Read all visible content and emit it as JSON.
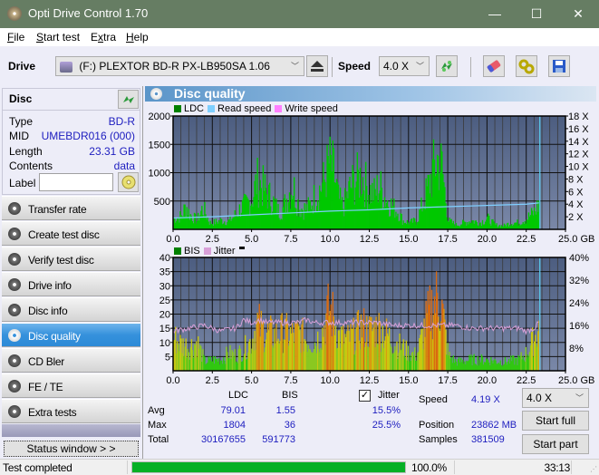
{
  "window": {
    "title": "Opti Drive Control 1.70",
    "minimize_label": "—",
    "maximize_label": "☐",
    "close_label": "✕"
  },
  "menu": {
    "items": [
      {
        "label": "File",
        "accel": "F",
        "rest": "ile"
      },
      {
        "label": "Start test",
        "accel": "S",
        "rest": "tart test"
      },
      {
        "label": "Extra",
        "accel_pre": "E",
        "accel": "x",
        "rest": "tra"
      },
      {
        "label": "Help",
        "accel": "H",
        "rest": "elp"
      }
    ]
  },
  "toolbar": {
    "drive_label": "Drive",
    "drive_value": "(F:)  PLEXTOR BD-R  PX-LB950SA 1.06",
    "speed_label": "Speed",
    "speed_value": "4.0 X",
    "icons": [
      "eject-icon",
      "refresh-icon",
      "erase-icon",
      "settings-icon",
      "save-icon"
    ]
  },
  "disc": {
    "header": "Disc",
    "rows": [
      {
        "label": "Type",
        "value": "BD-R"
      },
      {
        "label": "MID",
        "value": "UMEBDR016 (000)"
      },
      {
        "label": "Length",
        "value": "23.31 GB"
      },
      {
        "label": "Contents",
        "value": "data"
      }
    ],
    "label_field_label": "Label",
    "label_field_value": ""
  },
  "nav": {
    "items": [
      {
        "label": "Transfer rate",
        "active": false
      },
      {
        "label": "Create test disc",
        "active": false
      },
      {
        "label": "Verify test disc",
        "active": false
      },
      {
        "label": "Drive info",
        "active": false
      },
      {
        "label": "Disc info",
        "active": false
      },
      {
        "label": "Disc quality",
        "active": true
      },
      {
        "label": "CD Bler",
        "active": false
      },
      {
        "label": "FE / TE",
        "active": false
      },
      {
        "label": "Extra tests",
        "active": false
      }
    ],
    "status_window_label": "Status window > >"
  },
  "panel": {
    "title": "Disc quality"
  },
  "chart_data": [
    {
      "type": "area",
      "title": "LDC / Read speed",
      "legend": [
        {
          "name": "LDC",
          "color": "#008000"
        },
        {
          "name": "Read speed",
          "color": "#7fcfff"
        },
        {
          "name": "Write speed",
          "color": "#ff80ff"
        }
      ],
      "legend_position": "top-left",
      "xlabel": "GB",
      "x_ticks": [
        "0.0",
        "2.5",
        "5.0",
        "7.5",
        "10.0",
        "12.5",
        "15.0",
        "17.5",
        "20.0",
        "22.5",
        "25.0 GB"
      ],
      "xlim": [
        0,
        25
      ],
      "y_ticks": [
        "500",
        "1000",
        "1500",
        "2000"
      ],
      "ylim": [
        0,
        2000
      ],
      "y2_ticks": [
        "2 X",
        "4 X",
        "6 X",
        "8 X",
        "10 X",
        "12 X",
        "14 X",
        "16 X",
        "18 X"
      ],
      "y2lim": [
        0,
        18
      ],
      "grid": true,
      "series": [
        {
          "name": "LDC",
          "x": [
            0.0,
            0.5,
            0.8,
            1.0,
            1.5,
            1.8,
            2.0,
            2.3,
            2.5,
            3.0,
            3.5,
            4.0,
            4.3,
            4.6,
            5.0,
            5.3,
            5.6,
            6.0,
            6.3,
            6.7,
            7.0,
            7.3,
            7.6,
            8.0,
            8.5,
            9.0,
            9.3,
            9.6,
            9.9,
            10.2,
            10.5,
            10.8,
            11.2,
            11.5,
            12.0,
            12.4,
            12.8,
            13.1,
            13.5,
            14.0,
            14.3,
            14.6,
            15.0,
            15.5,
            16.0,
            16.5,
            16.8,
            17.1,
            17.5,
            18.0,
            18.5,
            19.0,
            19.5,
            20.0,
            20.5,
            21.0,
            21.5,
            22.0,
            22.5,
            23.0,
            23.31
          ],
          "values": [
            250,
            300,
            550,
            350,
            200,
            450,
            400,
            150,
            150,
            200,
            180,
            350,
            500,
            550,
            700,
            1100,
            1000,
            800,
            650,
            400,
            500,
            800,
            1000,
            500,
            450,
            750,
            900,
            1100,
            1500,
            1300,
            700,
            500,
            900,
            1100,
            1200,
            900,
            800,
            1000,
            700,
            500,
            400,
            200,
            150,
            200,
            700,
            1300,
            1600,
            1400,
            200,
            100,
            150,
            200,
            150,
            250,
            100,
            80,
            150,
            150,
            250,
            400,
            600
          ]
        },
        {
          "name": "Read speed",
          "x": [
            0.0,
            2.5,
            5.0,
            7.5,
            10.0,
            12.5,
            15.0,
            17.5,
            20.0,
            22.5,
            23.31
          ],
          "values": [
            1.8,
            2.0,
            2.3,
            2.6,
            2.9,
            3.1,
            3.4,
            3.6,
            3.8,
            4.0,
            4.2
          ]
        }
      ]
    },
    {
      "type": "area",
      "title": "BIS / Jitter",
      "legend": [
        {
          "name": "BIS",
          "color": "#008000"
        },
        {
          "name": "Jitter",
          "color": "#d8a0d8"
        }
      ],
      "legend_position": "top-left",
      "xlabel": "GB",
      "x_ticks": [
        "0.0",
        "2.5",
        "5.0",
        "7.5",
        "10.0",
        "12.5",
        "15.0",
        "17.5",
        "20.0",
        "22.5",
        "25.0 GB"
      ],
      "xlim": [
        0,
        25
      ],
      "y_ticks": [
        "5",
        "10",
        "15",
        "20",
        "25",
        "30",
        "35",
        "40"
      ],
      "ylim": [
        0,
        40
      ],
      "y2_ticks": [
        "8%",
        "16%",
        "24%",
        "32%",
        "40%"
      ],
      "y2lim": [
        0,
        40
      ],
      "grid": true,
      "series": [
        {
          "name": "BIS",
          "x": [
            0.0,
            0.5,
            1.0,
            1.5,
            2.0,
            2.5,
            3.0,
            3.5,
            4.0,
            4.5,
            5.0,
            5.3,
            5.6,
            6.0,
            6.5,
            7.0,
            7.5,
            8.0,
            8.5,
            9.0,
            9.5,
            9.9,
            10.2,
            10.5,
            11.0,
            11.5,
            12.0,
            12.5,
            13.0,
            13.5,
            14.0,
            14.5,
            15.0,
            15.5,
            16.0,
            16.5,
            16.8,
            17.1,
            17.5,
            18.0,
            19.0,
            20.0,
            21.0,
            22.0,
            22.5,
            23.0,
            23.31
          ],
          "values": [
            15,
            12,
            11,
            13,
            4,
            5,
            5,
            8,
            7,
            10,
            14,
            22,
            19,
            17,
            16,
            18,
            16,
            17,
            14,
            13,
            18,
            28,
            24,
            16,
            14,
            16,
            20,
            18,
            20,
            17,
            13,
            11,
            8,
            7,
            20,
            30,
            33,
            28,
            7,
            4,
            5,
            5,
            4,
            5,
            8,
            15,
            20
          ]
        },
        {
          "name": "Jitter",
          "x": [
            0.0,
            1.0,
            2.0,
            3.0,
            4.0,
            4.5,
            5.0,
            5.5,
            6.0,
            7.0,
            8.0,
            8.5,
            9.0,
            10.0,
            11.0,
            12.0,
            13.0,
            14.0,
            15.0,
            16.0,
            17.0,
            18.0,
            19.0,
            20.0,
            21.0,
            22.0,
            22.5,
            23.0,
            23.31
          ],
          "values": [
            14,
            15,
            16,
            14,
            15,
            18,
            17,
            18,
            17,
            17,
            17,
            18,
            17,
            17,
            17,
            17,
            17,
            16,
            16,
            16,
            16,
            16,
            15,
            15,
            15,
            15,
            14,
            15,
            17
          ]
        }
      ]
    }
  ],
  "stats": {
    "col_ldc": "LDC",
    "col_bis": "BIS",
    "jitter_label": "Jitter",
    "jitter_checked": true,
    "rows": [
      {
        "label": "Avg",
        "ldc": "79.01",
        "bis": "1.55",
        "jitter": "15.5%"
      },
      {
        "label": "Max",
        "ldc": "1804",
        "bis": "36",
        "jitter": "25.5%"
      },
      {
        "label": "Total",
        "ldc": "30167655",
        "bis": "591773",
        "jitter": ""
      }
    ],
    "speed_label": "Speed",
    "speed_value": "4.19 X",
    "position_label": "Position",
    "position_value": "23862 MB",
    "samples_label": "Samples",
    "samples_value": "381509",
    "speed_select": "4.0 X",
    "start_full_label": "Start full",
    "start_part_label": "Start part"
  },
  "statusbar": {
    "status_text": "Test completed",
    "progress_percent": 100.0,
    "progress_label": "100.0%",
    "elapsed": "33:13"
  }
}
